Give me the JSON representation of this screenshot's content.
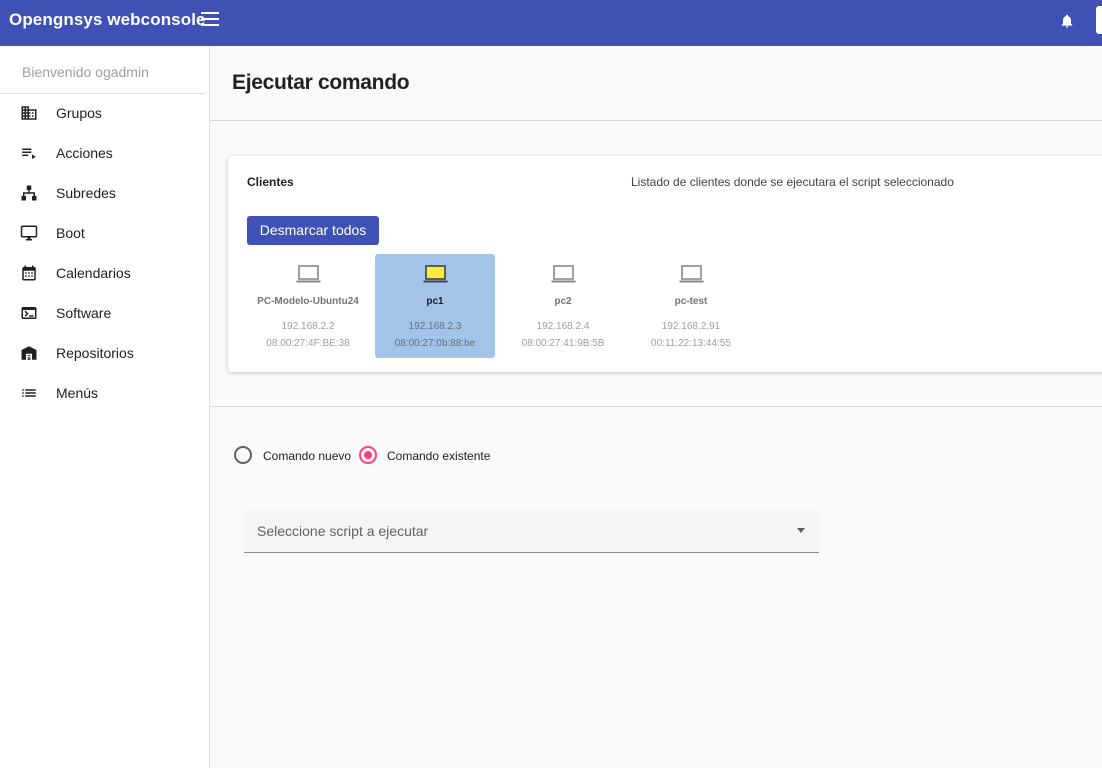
{
  "app": {
    "title": "Opengnsys webconsole"
  },
  "colors": {
    "primary": "#3f51b5",
    "accent": "#ff4081",
    "selected_bg": "#a4c3e8"
  },
  "topbar": {
    "menu_icon": "hamburger-menu-icon",
    "notifications_icon": "bell-icon"
  },
  "sidebar": {
    "welcome": "Bienvenido ogadmin",
    "items": [
      {
        "label": "Grupos",
        "icon": "building-icon"
      },
      {
        "label": "Acciones",
        "icon": "playlist-icon"
      },
      {
        "label": "Subredes",
        "icon": "sitemap-icon"
      },
      {
        "label": "Boot",
        "icon": "monitor-icon"
      },
      {
        "label": "Calendarios",
        "icon": "calendar-icon"
      },
      {
        "label": "Software",
        "icon": "console-icon"
      },
      {
        "label": "Repositorios",
        "icon": "warehouse-icon"
      },
      {
        "label": "Menús",
        "icon": "list-icon"
      }
    ]
  },
  "main": {
    "title": "Ejecutar comando",
    "clients_card": {
      "label": "Clientes",
      "description": "Listado de clientes donde se ejecutara el script seleccionado",
      "unselect_all_label": "Desmarcar todos",
      "clients": [
        {
          "name": "PC-Modelo-Ubuntu24",
          "ip": "192.168.2.2",
          "mac": "08:00:27:4F:BE:38",
          "selected": false
        },
        {
          "name": "pc1",
          "ip": "192.168.2.3",
          "mac": "08:00:27:0b:88:be",
          "selected": true
        },
        {
          "name": "pc2",
          "ip": "192.168.2.4",
          "mac": "08:00:27:41:9B:5B",
          "selected": false
        },
        {
          "name": "pc-test",
          "ip": "192.168.2.91",
          "mac": "00:11:22:13:44:55",
          "selected": false
        }
      ]
    },
    "command_mode": {
      "options": [
        {
          "label": "Comando nuevo",
          "checked": false
        },
        {
          "label": "Comando existente",
          "checked": true
        }
      ]
    },
    "script_select": {
      "placeholder": "Seleccione script a ejecutar"
    }
  }
}
